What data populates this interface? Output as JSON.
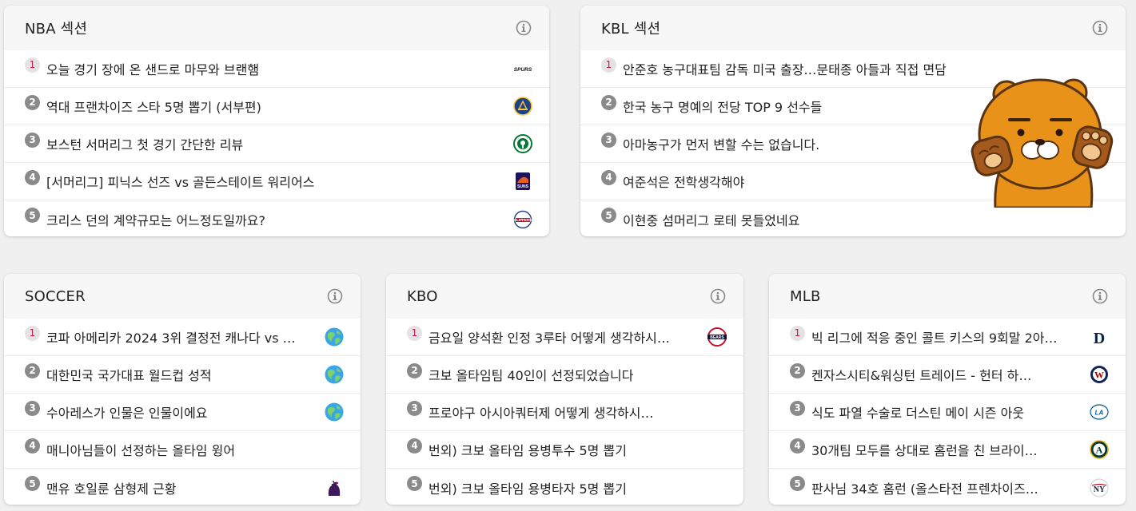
{
  "nba": {
    "title": "NBA 섹션",
    "items": [
      {
        "rank": "1",
        "title": "오늘 경기 장에 온 샌드로 마무와 브랜햄",
        "logo": "spurs-logo"
      },
      {
        "rank": "2",
        "title": "역대 프랜차이즈 스타 5명 뽑기 (서부편)",
        "logo": "warriors-logo"
      },
      {
        "rank": "3",
        "title": "보스턴 서머리그 첫 경기 간단한 리뷰",
        "logo": "celtics-logo"
      },
      {
        "rank": "4",
        "title": "[서머리그] 피닉스 선즈 vs 골든스테이트 워리어스",
        "logo": "suns-logo"
      },
      {
        "rank": "5",
        "title": "크리스 던의 계약규모는 어느정도일까요?",
        "logo": "clippers-logo"
      }
    ]
  },
  "kbl": {
    "title": "KBL 섹션",
    "items": [
      {
        "rank": "1",
        "title": "안준호 농구대표팀 감독 미국 출장…문태종 아들과 직접 면담"
      },
      {
        "rank": "2",
        "title": "한국 농구 명예의 전당 TOP 9 선수들"
      },
      {
        "rank": "3",
        "title": "아마농구가 먼저 변할 수는 없습니다."
      },
      {
        "rank": "4",
        "title": "여준석은 전학생각해야"
      },
      {
        "rank": "5",
        "title": "이현중 섬머리그 로테 못들었네요"
      }
    ]
  },
  "soccer": {
    "title": "SOCCER",
    "items": [
      {
        "rank": "1",
        "title": "코파 아메리카 2024 3위 결정전 캐나다 vs …",
        "logo": "globe-icon"
      },
      {
        "rank": "2",
        "title": "대한민국 국가대표 월드컵 성적",
        "logo": "globe-icon"
      },
      {
        "rank": "3",
        "title": "수아레스가 인물은 인물이에요",
        "logo": "globe-icon"
      },
      {
        "rank": "4",
        "title": "매니아님들이 선정하는 올타임 윙어",
        "logo": ""
      },
      {
        "rank": "5",
        "title": "맨유 호일룬 삼형제 근황",
        "logo": "premier-league-logo"
      }
    ]
  },
  "kbo": {
    "title": "KBO",
    "items": [
      {
        "rank": "1",
        "title": "금요일 양석환 인정 3루타 어떻게 생각하시…",
        "logo": "bears-logo"
      },
      {
        "rank": "2",
        "title": "크보 올타임팀 40인이 선정되었습니다",
        "logo": ""
      },
      {
        "rank": "3",
        "title": "프로야구 아시아쿼터제 어떻게 생각하시…",
        "logo": ""
      },
      {
        "rank": "4",
        "title": "번외) 크보 올타임 용병투수 5명 뽑기",
        "logo": ""
      },
      {
        "rank": "5",
        "title": "번외) 크보 올타임 용병타자 5명 뽑기",
        "logo": ""
      }
    ]
  },
  "mlb": {
    "title": "MLB",
    "items": [
      {
        "rank": "1",
        "title": "빅 리그에 적응 중인 콜트 키스의 9회말 2아…",
        "logo": "tigers-logo"
      },
      {
        "rank": "2",
        "title": "켄자스시티&워싱턴 트레이드 - 헌터 하…",
        "logo": "nationals-logo"
      },
      {
        "rank": "3",
        "title": "식도 파열 수술로 더스틴 메이 시즌 아웃",
        "logo": "dodgers-logo"
      },
      {
        "rank": "4",
        "title": "30개팀 모두를 상대로 홈런을 친 브라이…",
        "logo": "athletics-logo"
      },
      {
        "rank": "5",
        "title": "판사님 34호 홈런 (올스타전 프렌차이즈…",
        "logo": "yankees-logo"
      }
    ]
  },
  "logos": {
    "spurs_text": "SPURS",
    "suns_text": "SUNS",
    "clippers_text": "CLIPPERS",
    "bears_text": "BEARS",
    "tigers_text": "D",
    "nationals_text": "W",
    "dodgers_text": "LA",
    "athletics_text": "A",
    "yankees_text": "NY"
  },
  "colors": {
    "rank_first_text": "#c2185b",
    "rank_bg": "#8a8a8a",
    "card_header_bg": "#f7f7f7",
    "page_bg": "#f0f0f0",
    "mascot": "#e8921a"
  },
  "icons": {
    "info": "info-icon",
    "mascot": "ryan-mascot"
  }
}
